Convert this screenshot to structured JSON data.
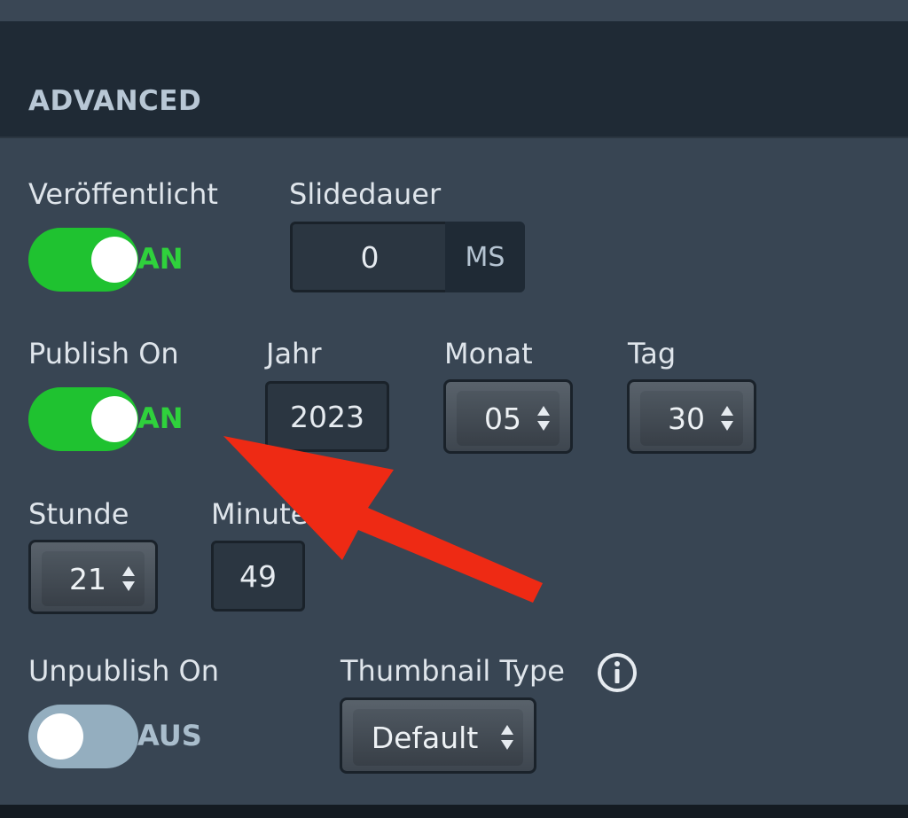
{
  "header": {
    "title": "ADVANCED"
  },
  "published": {
    "label": "Veröffentlicht",
    "state": "AN"
  },
  "slide_duration": {
    "label": "Slidedauer",
    "value": "0",
    "unit": "MS"
  },
  "publish_on": {
    "label": "Publish On",
    "state": "AN"
  },
  "year": {
    "label": "Jahr",
    "value": "2023"
  },
  "month": {
    "label": "Monat",
    "value": "05"
  },
  "day": {
    "label": "Tag",
    "value": "30"
  },
  "hour": {
    "label": "Stunde",
    "value": "21"
  },
  "minute": {
    "label": "Minute",
    "value": "49"
  },
  "unpublish_on": {
    "label": "Unpublish On",
    "state": "AUS"
  },
  "thumbnail_type": {
    "label": "Thumbnail Type",
    "value": "Default",
    "info_icon": "info-icon"
  },
  "annotation": {
    "icon": "red-arrow",
    "color": "#ee2a14"
  },
  "colors": {
    "toggle_on": "#1fc230",
    "toggle_off": "#94aebf",
    "panel": "#384553",
    "header": "#1f2a35"
  }
}
